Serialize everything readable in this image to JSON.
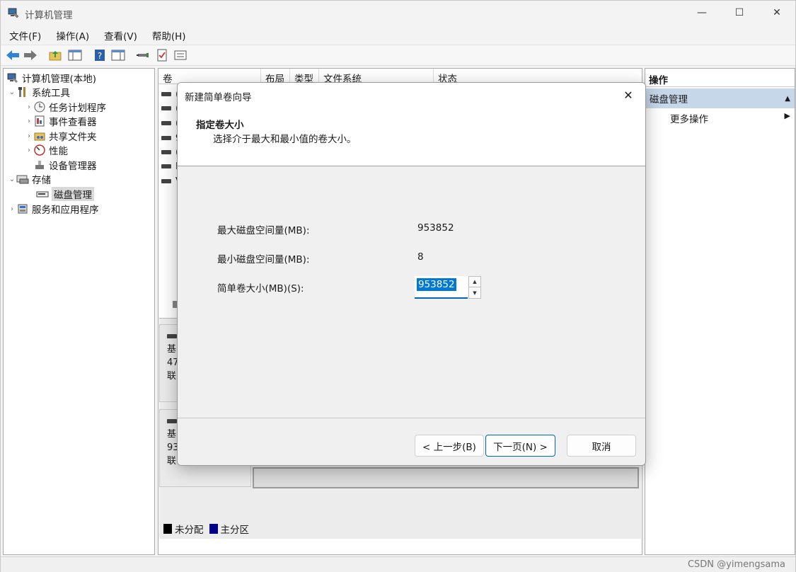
{
  "window": {
    "title": "计算机管理",
    "minimize": "—",
    "maximize": "☐",
    "close": "✕"
  },
  "menu": [
    "文件(F)",
    "操作(A)",
    "查看(V)",
    "帮助(H)"
  ],
  "tree": {
    "root": "计算机管理(本地)",
    "system_tools": "系统工具",
    "task_scheduler": "任务计划程序",
    "event_viewer": "事件查看器",
    "shared_folders": "共享文件夹",
    "performance": "性能",
    "device_manager": "设备管理器",
    "storage": "存储",
    "disk_management": "磁盘管理",
    "services_apps": "服务和应用程序"
  },
  "columns": [
    "卷",
    "布局",
    "类型",
    "文件系统",
    "状态"
  ],
  "volume_rows": [
    "(",
    "(",
    "(",
    "9",
    "(",
    "F",
    "V"
  ],
  "disks": [
    {
      "l1": "基",
      "l2": "47",
      "l3": "联"
    },
    {
      "l1": "基",
      "l2": "93",
      "l3": "联"
    }
  ],
  "legend": {
    "unallocated": "未分配",
    "unallocated_color": "#000000",
    "primary": "主分区",
    "primary_color": "#00008b"
  },
  "actions": {
    "header": "操作",
    "section": "磁盘管理",
    "more": "更多操作"
  },
  "dialog": {
    "title": "新建简单卷向导",
    "heading": "指定卷大小",
    "subheading": "选择介于最大和最小值的卷大小。",
    "max_label": "最大磁盘空间量(MB):",
    "max_value": "953852",
    "min_label": "最小磁盘空间量(MB):",
    "min_value": "8",
    "size_label": "简单卷大小(MB)(S):",
    "size_value": "953852",
    "back": "< 上一步(B)",
    "next": "下一页(N) >",
    "cancel": "取消"
  },
  "watermark": "CSDN @yimengsama"
}
